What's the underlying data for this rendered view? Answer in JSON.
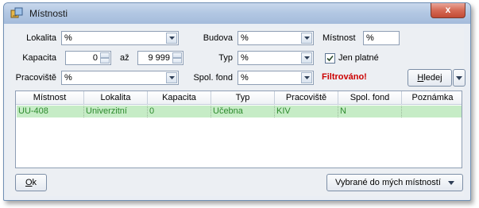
{
  "window": {
    "title": "Místnosti",
    "close_symbol": "x"
  },
  "filters": {
    "lokalita": {
      "label": "Lokalita",
      "value": "%"
    },
    "budova": {
      "label": "Budova",
      "value": "%"
    },
    "mistnost": {
      "label": "Místnost",
      "value": "%"
    },
    "kapacita": {
      "label": "Kapacita",
      "from": "0",
      "sep": "až",
      "to": "9 999"
    },
    "typ": {
      "label": "Typ",
      "value": "%"
    },
    "jen_platne": {
      "label": "Jen platné",
      "checked": true
    },
    "pracoviste": {
      "label": "Pracoviště",
      "value": "%"
    },
    "spol_fond": {
      "label": "Spol. fond",
      "value": "%"
    },
    "status": "Filtrováno!",
    "search_button": {
      "label_underlined": "H",
      "label_rest": "ledej"
    }
  },
  "table": {
    "columns": [
      "Místnost",
      "Lokalita",
      "Kapacita",
      "Typ",
      "Pracoviště",
      "Spol. fond",
      "Poznámka"
    ],
    "rows": [
      [
        "UU-408",
        "Univerzitní",
        "0",
        "Učebna",
        "KIV",
        "N",
        ""
      ]
    ]
  },
  "footer": {
    "ok_button": {
      "label_underlined": "O",
      "label_rest": "k"
    },
    "my_rooms_button": "Vybrané do mých místností"
  },
  "colors": {
    "accent_status": "#cc0000",
    "selected_row": "#c6ecc6",
    "row_text": "#2e8b2e"
  },
  "icons": {
    "title": "rooms-icon",
    "combo": "dropdown-arrow-icon",
    "check": "checkmark-icon"
  }
}
